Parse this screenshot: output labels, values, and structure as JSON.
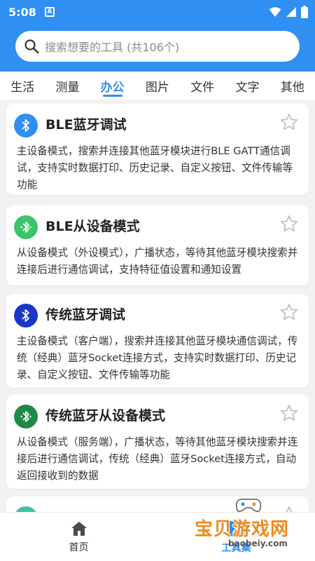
{
  "status_bar": {
    "time": "5:08",
    "notif_letter": "A"
  },
  "search": {
    "placeholder": "搜索想要的工具 (共106个)"
  },
  "tabs": [
    {
      "label": "生活",
      "active": false
    },
    {
      "label": "测量",
      "active": false
    },
    {
      "label": "办公",
      "active": true
    },
    {
      "label": "图片",
      "active": false
    },
    {
      "label": "文件",
      "active": false
    },
    {
      "label": "文字",
      "active": false
    },
    {
      "label": "其他",
      "active": false
    }
  ],
  "cards": [
    {
      "title": "BLE蓝牙调试",
      "icon": "bluetooth-icon",
      "icon_color": "#2f8ff2",
      "desc": "主设备模式，搜索并连接其他蓝牙模块进行BLE GATT通信调试，支持实时数据打印、历史记录、自定义按钮、文件传输等功能"
    },
    {
      "title": "BLE从设备模式",
      "icon": "bluetooth-signal-icon",
      "icon_color": "#3cc46a",
      "desc": "从设备模式（外设模式），广播状态，等待其他蓝牙模块搜索并连接后进行通信调试，支持特征值设置和通知设置"
    },
    {
      "title": "传统蓝牙调试",
      "icon": "bluetooth-icon",
      "icon_color": "#1a36c8",
      "desc": "主设备模式（客户端），搜索并连接其他蓝牙模块通信调试，传统（经典）蓝牙Socket连接方式，支持实时数据打印、历史记录、自定义按钮、文件传输等功能"
    },
    {
      "title": "传统蓝牙从设备模式",
      "icon": "bluetooth-signal-icon",
      "icon_color": "#1f8a47",
      "desc": "从设备模式（服务端），广播状态，等待其他蓝牙模块搜索并连接后进行通信调试，传统（经典）蓝牙Socket连接方式，自动返回接收到的数据"
    },
    {
      "title": "",
      "icon": "tool-icon",
      "icon_color": "#3cc4a8",
      "desc": ""
    }
  ],
  "bottom_nav": [
    {
      "label": "首页",
      "icon": "home-icon",
      "active": false
    },
    {
      "label": "工具集",
      "icon": "toolbox-icon",
      "active": true
    }
  ],
  "watermark": {
    "text": "宝贝游戏网",
    "url": "baobeiy.com"
  },
  "colors": {
    "primary": "#2f8ff2",
    "background": "#f2f2f4",
    "watermark": "#f08a1d"
  }
}
